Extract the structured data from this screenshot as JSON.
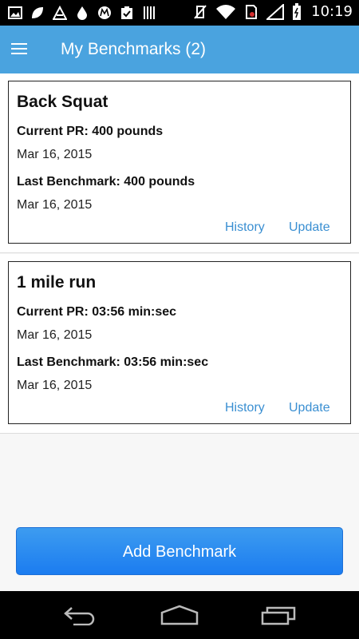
{
  "status_bar": {
    "time": "10:19",
    "left_icons": [
      "image-icon",
      "leaf-icon",
      "android-icon",
      "drop-icon",
      "motorola-icon",
      "clipboard-check-icon",
      "barcode-icon"
    ],
    "right_icons": [
      "no-vibrate-icon",
      "wifi-icon",
      "no-sim-icon",
      "signal-icon",
      "battery-icon"
    ]
  },
  "app_bar": {
    "title": "My Benchmarks (2)",
    "menu_icon": "hamburger-menu-icon"
  },
  "benchmarks": [
    {
      "name": "Back Squat",
      "current_pr_label": "Current PR: 400 pounds",
      "current_pr_date": "Mar 16, 2015",
      "last_benchmark_label": "Last Benchmark: 400 pounds",
      "last_benchmark_date": "Mar 16, 2015",
      "history_label": "History",
      "update_label": "Update"
    },
    {
      "name": "1 mile run",
      "current_pr_label": "Current PR: 03:56 min:sec",
      "current_pr_date": "Mar 16, 2015",
      "last_benchmark_label": "Last Benchmark: 03:56 min:sec",
      "last_benchmark_date": "Mar 16, 2015",
      "history_label": "History",
      "update_label": "Update"
    }
  ],
  "add_button_label": "Add Benchmark",
  "nav_bar": {
    "back_icon": "back-icon",
    "home_icon": "home-icon",
    "recents_icon": "recents-icon"
  },
  "colors": {
    "app_bar": "#4aa3df",
    "link": "#3a8fd2",
    "button": "#1b7cf0"
  }
}
